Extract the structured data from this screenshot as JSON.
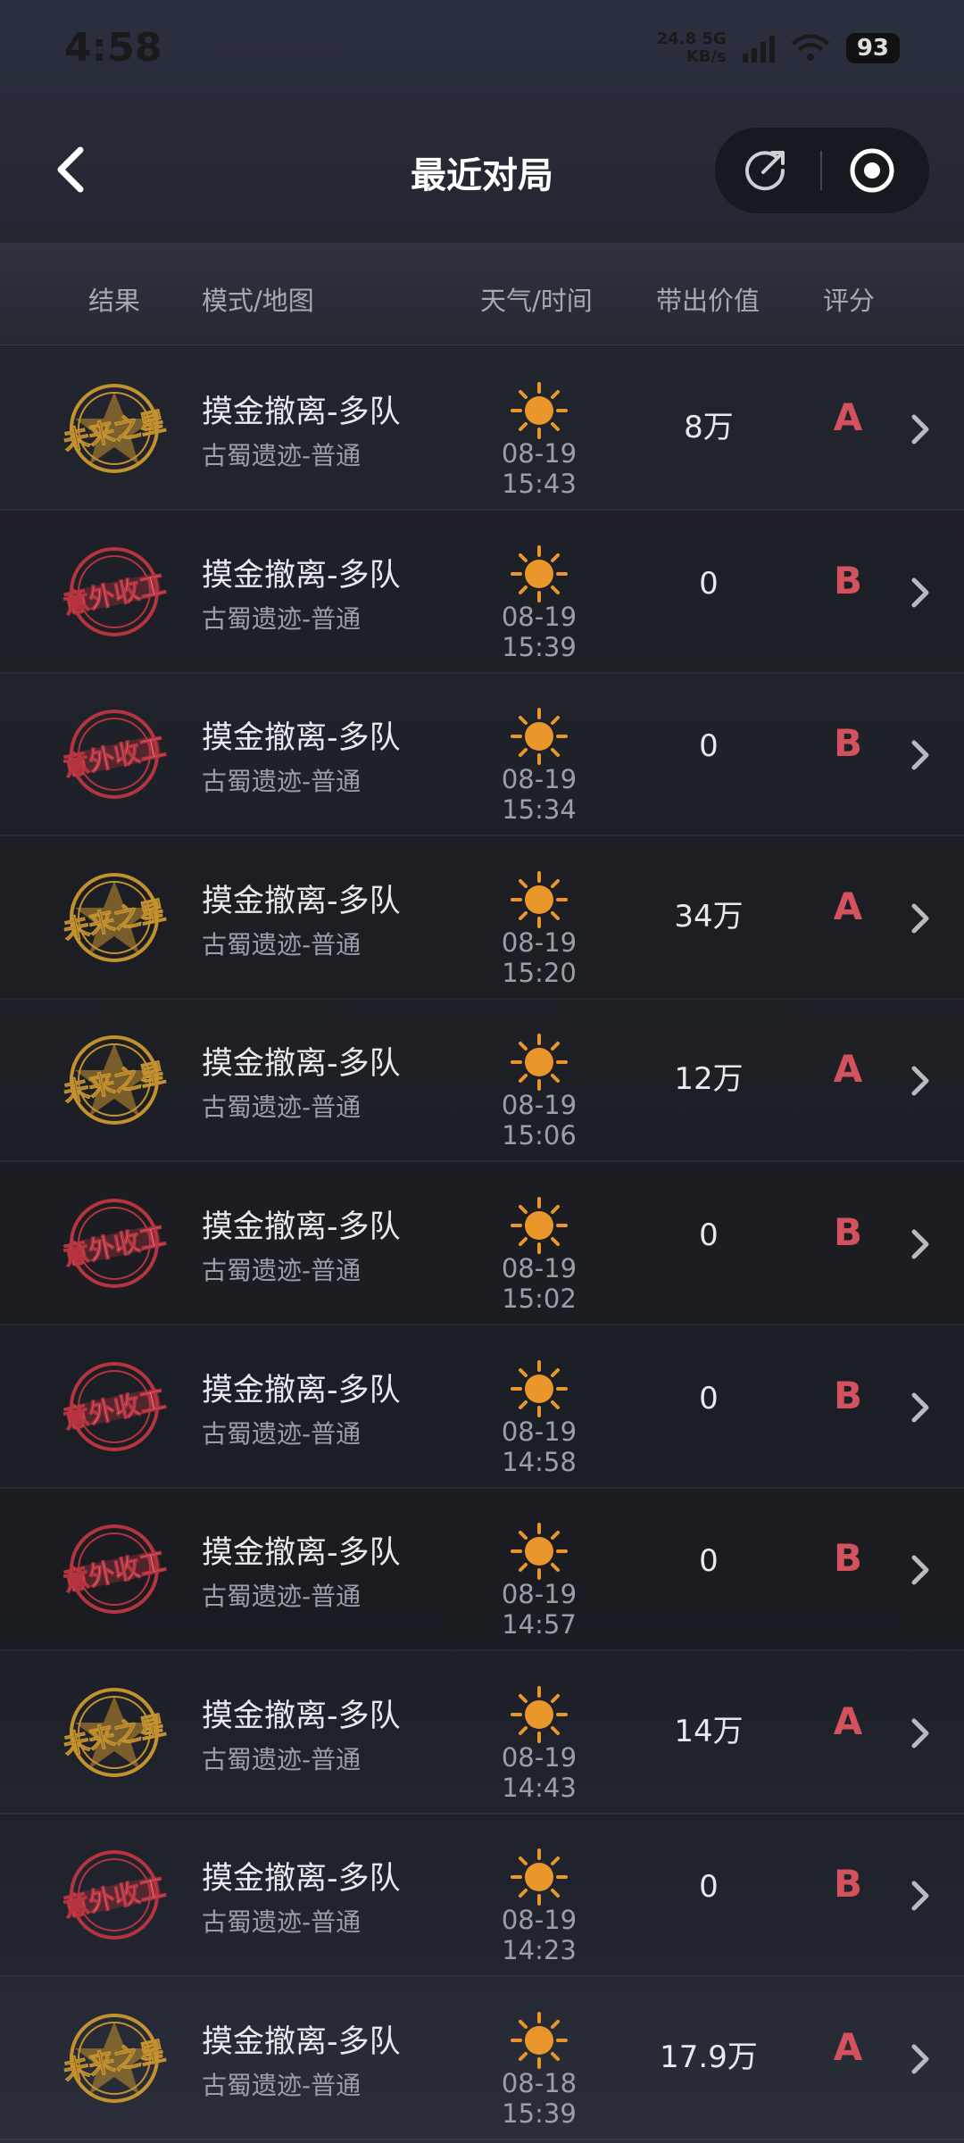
{
  "status_bar": {
    "time": "4:58",
    "net_speed_value": "24.8",
    "net_speed_unit": "KB/s",
    "network_type": "5G",
    "battery": "93"
  },
  "header": {
    "title": "最近对局",
    "icons": {
      "back": "back-arrow-icon",
      "share": "share-icon",
      "close": "close-target-icon"
    }
  },
  "columns": {
    "result": "结果",
    "mode_map": "模式/地图",
    "weather_time": "天气/时间",
    "value": "带出价值",
    "score": "评分"
  },
  "colors": {
    "star_gold": "#c4912f",
    "fail_red": "#b5343f",
    "grade": "#d4525e",
    "sun": "#e9962b"
  },
  "matches": [
    {
      "badge": "未来之星",
      "badge_type": "star",
      "mode": "摸金撤离-多队",
      "map": "古蜀遗迹-普通",
      "weather": "sunny",
      "time": "08-19 15:43",
      "value": "8万",
      "grade": "A"
    },
    {
      "badge": "意外收工",
      "badge_type": "fail",
      "mode": "摸金撤离-多队",
      "map": "古蜀遗迹-普通",
      "weather": "sunny",
      "time": "08-19 15:39",
      "value": "0",
      "grade": "B"
    },
    {
      "badge": "意外收工",
      "badge_type": "fail",
      "mode": "摸金撤离-多队",
      "map": "古蜀遗迹-普通",
      "weather": "sunny",
      "time": "08-19 15:34",
      "value": "0",
      "grade": "B"
    },
    {
      "badge": "未来之星",
      "badge_type": "star",
      "mode": "摸金撤离-多队",
      "map": "古蜀遗迹-普通",
      "weather": "sunny",
      "time": "08-19 15:20",
      "value": "34万",
      "grade": "A"
    },
    {
      "badge": "未来之星",
      "badge_type": "star",
      "mode": "摸金撤离-多队",
      "map": "古蜀遗迹-普通",
      "weather": "sunny",
      "time": "08-19 15:06",
      "value": "12万",
      "grade": "A"
    },
    {
      "badge": "意外收工",
      "badge_type": "fail",
      "mode": "摸金撤离-多队",
      "map": "古蜀遗迹-普通",
      "weather": "sunny",
      "time": "08-19 15:02",
      "value": "0",
      "grade": "B"
    },
    {
      "badge": "意外收工",
      "badge_type": "fail",
      "mode": "摸金撤离-多队",
      "map": "古蜀遗迹-普通",
      "weather": "sunny",
      "time": "08-19 14:58",
      "value": "0",
      "grade": "B"
    },
    {
      "badge": "意外收工",
      "badge_type": "fail",
      "mode": "摸金撤离-多队",
      "map": "古蜀遗迹-普通",
      "weather": "sunny",
      "time": "08-19 14:57",
      "value": "0",
      "grade": "B"
    },
    {
      "badge": "未来之星",
      "badge_type": "star",
      "mode": "摸金撤离-多队",
      "map": "古蜀遗迹-普通",
      "weather": "sunny",
      "time": "08-19 14:43",
      "value": "14万",
      "grade": "A"
    },
    {
      "badge": "意外收工",
      "badge_type": "fail",
      "mode": "摸金撤离-多队",
      "map": "古蜀遗迹-普通",
      "weather": "sunny",
      "time": "08-19 14:23",
      "value": "0",
      "grade": "B"
    },
    {
      "badge": "未来之星",
      "badge_type": "star",
      "mode": "摸金撤离-多队",
      "map": "古蜀遗迹-普通",
      "weather": "sunny",
      "time": "08-18 15:39",
      "value": "17.9万",
      "grade": "A"
    }
  ]
}
